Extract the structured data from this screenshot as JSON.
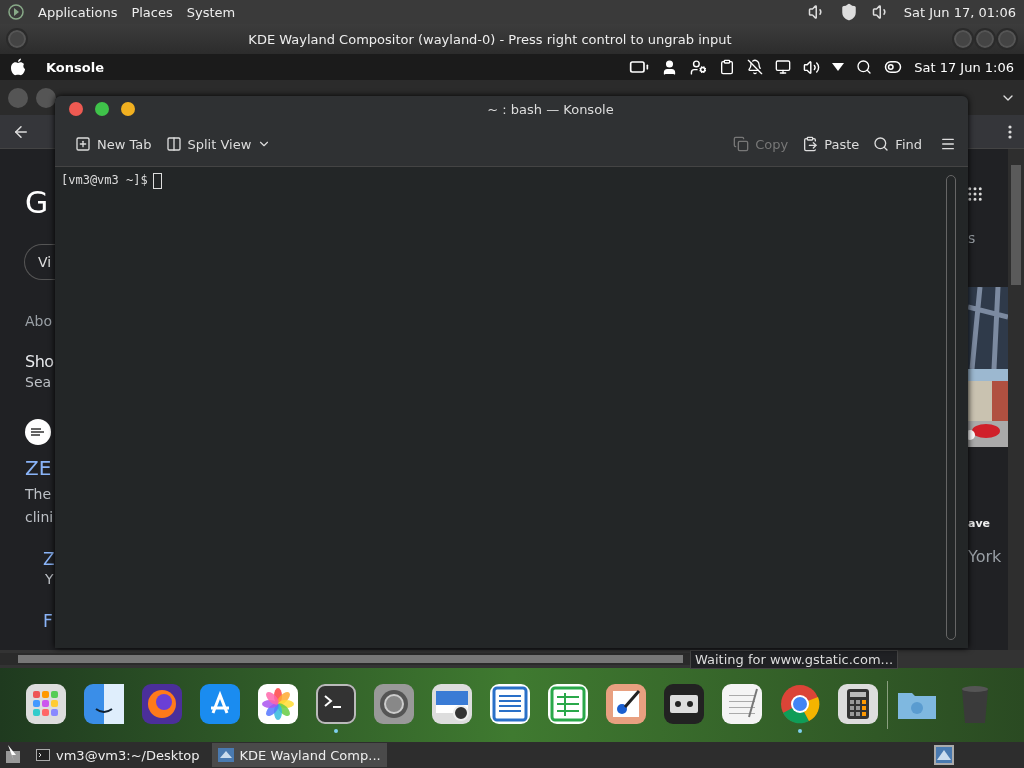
{
  "top_panel": {
    "menus": [
      "Applications",
      "Places",
      "System"
    ],
    "clock": "Sat Jun 17, 01:06"
  },
  "vm_window": {
    "title": "KDE Wayland Compositor (wayland-0) - Press right control to ungrab input"
  },
  "menu_bar": {
    "app": "Konsole",
    "clock": "Sat 17 Jun 1:06"
  },
  "browser": {
    "left_items": [
      {
        "kind": "logo",
        "text": "G"
      },
      {
        "kind": "chip",
        "text": "Vi"
      },
      {
        "kind": "muted",
        "text": "Abo"
      },
      {
        "kind": "heading",
        "text": "Sho"
      },
      {
        "kind": "sub",
        "text": "Sea"
      },
      {
        "kind": "favicon"
      },
      {
        "kind": "link",
        "text": "ZE"
      },
      {
        "kind": "body",
        "text": "The"
      },
      {
        "kind": "body",
        "text": "clini"
      },
      {
        "kind": "sublink",
        "text": "Z"
      },
      {
        "kind": "subtext",
        "text": "Y"
      },
      {
        "kind": "sublink",
        "text": "F"
      }
    ],
    "right_items": [
      {
        "kind": "muted",
        "text": "s"
      },
      {
        "kind": "map"
      },
      {
        "kind": "bold",
        "text": "ave"
      },
      {
        "kind": "large",
        "text": "York"
      }
    ],
    "status": "Waiting for www.gstatic.com..."
  },
  "konsole": {
    "title": "~ : bash — Konsole",
    "toolbar": [
      {
        "kind": "newtab",
        "label": "New Tab",
        "disabled": false
      },
      {
        "kind": "split",
        "label": "Split View",
        "disabled": false
      },
      {
        "kind": "copy",
        "label": "Copy",
        "disabled": true
      },
      {
        "kind": "paste",
        "label": "Paste",
        "disabled": false
      },
      {
        "kind": "find",
        "label": "Find",
        "disabled": false
      }
    ],
    "prompt": "[vm3@vm3 ~]$"
  },
  "dock": {
    "apps": [
      {
        "kind": "launchpad",
        "running": false
      },
      {
        "kind": "finder",
        "running": false
      },
      {
        "kind": "firefox",
        "running": false
      },
      {
        "kind": "appstore",
        "running": false
      },
      {
        "kind": "photos",
        "running": false
      },
      {
        "kind": "terminal",
        "running": true
      },
      {
        "kind": "settings",
        "running": false
      },
      {
        "kind": "preview",
        "running": false
      },
      {
        "kind": "writer",
        "running": false
      },
      {
        "kind": "sheet",
        "running": false
      },
      {
        "kind": "paint",
        "running": false
      },
      {
        "kind": "tape",
        "running": false
      },
      {
        "kind": "textedit",
        "running": false
      },
      {
        "kind": "chrome",
        "running": true
      },
      {
        "kind": "calculator",
        "running": false
      },
      {
        "kind": "separator"
      },
      {
        "kind": "folder",
        "running": false
      },
      {
        "kind": "trash",
        "running": false
      }
    ]
  },
  "taskbar": {
    "tasks": [
      {
        "label": "vm3@vm3:~/Desktop",
        "selected": false,
        "kind": "terminal"
      },
      {
        "label": "KDE Wayland Comp...",
        "selected": true,
        "kind": "vm"
      }
    ]
  }
}
